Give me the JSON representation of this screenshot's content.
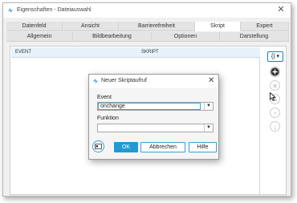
{
  "window": {
    "title": "Eigenschaften - Dateiauswahl",
    "close_glyph": "✕"
  },
  "tabs_row1": [
    {
      "label": "Datenfeld"
    },
    {
      "label": "Ansicht"
    },
    {
      "label": "Barrierefreiheit"
    },
    {
      "label": "Skript"
    },
    {
      "label": "Expert"
    }
  ],
  "active_tab": "Skript",
  "tabs_row2": [
    {
      "label": "Allgemein"
    },
    {
      "label": "Bildbearbeitung"
    },
    {
      "label": "Optionen"
    },
    {
      "label": "Darstellung"
    }
  ],
  "table": {
    "columns": [
      "EVENT",
      "SKRIPT"
    ]
  },
  "side_toolbar": {
    "script_button": "{} ▾",
    "icons": [
      "add-icon",
      "remove-icon",
      "edit-icon",
      "move-up-icon",
      "move-down-icon"
    ]
  },
  "dialog": {
    "title": "Neuer Skriptaufruf",
    "close_glyph": "✕",
    "event_label": "Event",
    "event_value": "onchange",
    "function_label": "Funktion",
    "function_value": "",
    "ok_label": "OK",
    "cancel_label": "Abbrechen",
    "help_label": "Hilfe"
  },
  "colors": {
    "accent": "#1f9ad6",
    "header_bg": "#e8f2fa"
  }
}
